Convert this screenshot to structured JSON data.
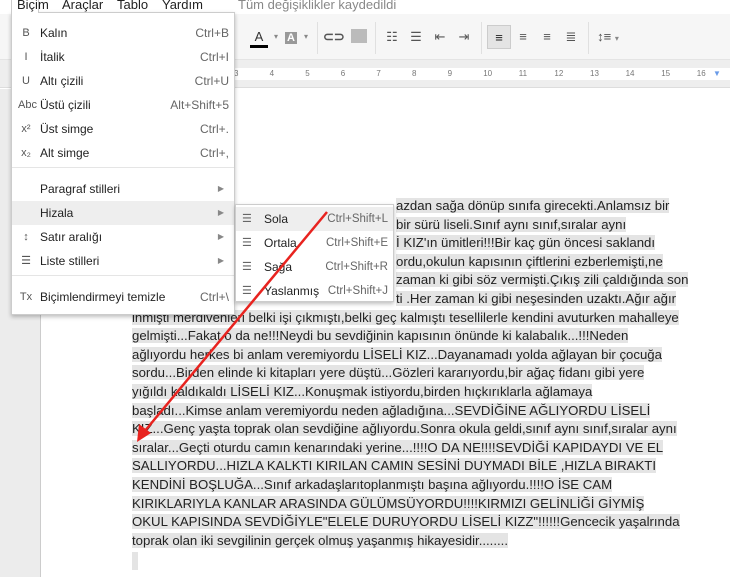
{
  "menubar": {
    "items": [
      "Biçim",
      "Araçlar",
      "Tablo",
      "Yardım"
    ],
    "status": "Tüm değişiklikler kaydedildi"
  },
  "toolbar": {
    "text_color_label": "A",
    "highlight_label": "A",
    "ruler_numbers": [
      "3",
      "4",
      "5",
      "6",
      "7",
      "8",
      "9",
      "10",
      "11",
      "12",
      "13",
      "14",
      "15",
      "16"
    ],
    "active_alignment": "left"
  },
  "format_menu": {
    "items": [
      {
        "icon": "bold-icon",
        "glyph": "B",
        "label": "Kalın",
        "shortcut": "Ctrl+B"
      },
      {
        "icon": "italic-icon",
        "glyph": "I",
        "label": "İtalik",
        "shortcut": "Ctrl+I"
      },
      {
        "icon": "underline-icon",
        "glyph": "U",
        "label": "Altı çizili",
        "shortcut": "Ctrl+U"
      },
      {
        "icon": "strikethrough-icon",
        "glyph": "Abc",
        "label": "Üstü çizili",
        "shortcut": "Alt+Shift+5"
      },
      {
        "icon": "superscript-icon",
        "glyph": "x²",
        "label": "Üst simge",
        "shortcut": "Ctrl+."
      },
      {
        "icon": "subscript-icon",
        "glyph": "x₂",
        "label": "Alt simge",
        "shortcut": "Ctrl+,"
      },
      {
        "label": "Paragraf stilleri",
        "submenu": true
      },
      {
        "label": "Hizala",
        "submenu": true,
        "highlighted": true
      },
      {
        "icon": "line-spacing-icon",
        "glyph": "↕",
        "label": "Satır aralığı",
        "submenu": true
      },
      {
        "icon": "list-styles-icon",
        "glyph": "☰",
        "label": "Liste stilleri",
        "submenu": true
      },
      {
        "icon": "clear-formatting-icon",
        "glyph": "Tx",
        "label": "Biçimlendirmeyi temizle",
        "shortcut": "Ctrl+\\"
      }
    ]
  },
  "align_submenu": {
    "items": [
      {
        "icon": "align-left-icon",
        "label": "Sola",
        "shortcut": "Ctrl+Shift+L",
        "highlighted": true
      },
      {
        "icon": "align-center-icon",
        "label": "Ortala",
        "shortcut": "Ctrl+Shift+E"
      },
      {
        "icon": "align-right-icon",
        "label": "Sağa",
        "shortcut": "Ctrl+Shift+R"
      },
      {
        "icon": "align-justify-icon",
        "label": "Yaslanmış",
        "shortcut": "Ctrl+Shift+J"
      }
    ]
  },
  "document": {
    "lines": [
      "azdan sağa dönüp sınıfa girecekti.Anlamsız bir",
      "bir sürü liseli.Sınıf aynı sınıf,sıralar aynı",
      "İ KIZ'ın ümitleri!!!Bir kaç gün öncesi saklandı",
      "ordu,okulun kapısının çiftlerini ezberlemişti,ne",
      "zaman ki gibi söz vermişti.Çıkış zili çaldığında son",
      "ti .Her zaman ki gibi neşesinden uzaktı.Ağır ağır",
      "inmişti merdivenleri belki işi çıkmıştı,belki geç kalmıştı tesellilerle kendini avuturken mahalleye",
      "gelmişti...Fakat o da ne!!!Neydi bu sevdiğinin kapısının önünde ki kalabalık...!!!Neden",
      "ağlıyordu herkes bi anlam veremiyordu LİSELİ KIZ...Dayanamadı yolda ağlayan bir çocuğa",
      "sordu...Birden elinde ki kitapları yere düştü...Gözleri kararıyordu,bir ağaç fidanı gibi yere",
      "yığıldı kaldıkaldı LİSELİ KIZ...Konuşmak istiyordu,birden hıçkırıklarla ağlamaya",
      "başladı...Kimse anlam veremiyordu neden ağladığına...SEVDİĞİNE AĞLIYORDU LİSELİ",
      "KIZ...Genç yaşta toprak olan sevdiğine ağlıyordu.Sonra okula geldi,sınıf aynı sınıf,sıralar aynı",
      "sıralar...Geçti oturdu camın kenarındaki yerine...!!!!O DA NE!!!!SEVDİĞİ KAPIDAYDI VE EL",
      "SALLIYORDU...HIZLA KALKTI KIRILAN CAMIN SESİNİ DUYMADI BİLE ,HIZLA BIRAKTI",
      "KENDİNİ BOŞLUĞA...Sınıf arkadaşlarıtoplanmıştı başına ağlıyordu.!!!!O İSE CAM",
      "KIRIKLARIYLA KANLAR ARASINDA GÜLÜMSÜYORDU!!!!KIRMIZI GELİNLİĞİ GİYMİŞ",
      "OKUL KAPISINDA SEVDİĞİYLE\"ELELE DURUYORDU LİSELİ KIZZ\"!!!!!!Gencecik yaşalrında",
      "toprak olan iki sevgilinin gerçek olmuş yaşanmış hikayesidir........"
    ]
  },
  "annotation": {
    "arrow_color": "#e8231f"
  },
  "colors": {
    "selection": "#e4e4e4",
    "menu_highlight": "#eeeeee"
  }
}
